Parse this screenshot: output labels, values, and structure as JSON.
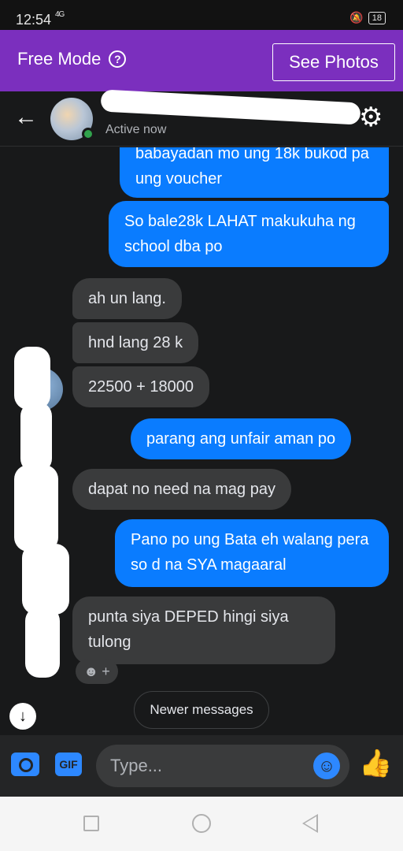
{
  "status_bar": {
    "time": "12:54",
    "network": "4G",
    "battery": "18"
  },
  "free_mode_bar": {
    "label": "Free Mode",
    "help_glyph": "?",
    "see_photos": "See Photos"
  },
  "header": {
    "back_glyph": "←",
    "status": "Active now",
    "settings_glyph": "⚙"
  },
  "messages": [
    {
      "side": "out",
      "text": "babayadan mo ung 18k bukod pa ung voucher"
    },
    {
      "side": "out",
      "text": "So bale28k LAHAT makukuha ng school dba po"
    },
    {
      "side": "in",
      "text": "ah un lang."
    },
    {
      "side": "in",
      "text": "hnd lang 28 k"
    },
    {
      "side": "in",
      "text": "22500 + 18000"
    },
    {
      "side": "out",
      "text": "parang ang unfair aman po"
    },
    {
      "side": "in",
      "text": "dapat no need na mag pay"
    },
    {
      "side": "out",
      "text": "Pano po ung Bata eh  walang pera so d na SYA magaaral"
    },
    {
      "side": "in",
      "text": "punta siya DEPED hingi siya tulong"
    }
  ],
  "reaction": {
    "emoji": "☻",
    "plus": "+"
  },
  "scroll_down": "↓",
  "newer_messages": "Newer messages",
  "composer": {
    "gif": "GIF",
    "placeholder": "Type...",
    "emoji_glyph": "☺",
    "like_glyph": "👍"
  },
  "colors": {
    "purple_bar": "#7b2fbe",
    "outgoing_bubble": "#0a7cff",
    "incoming_bubble": "#3a3b3c",
    "accent": "#2d88ff"
  },
  "icons": [
    "back-arrow-icon",
    "gear-icon",
    "camera-icon",
    "gif-icon",
    "emoji-icon",
    "thumbs-up-icon",
    "scroll-down-icon",
    "help-icon"
  ]
}
